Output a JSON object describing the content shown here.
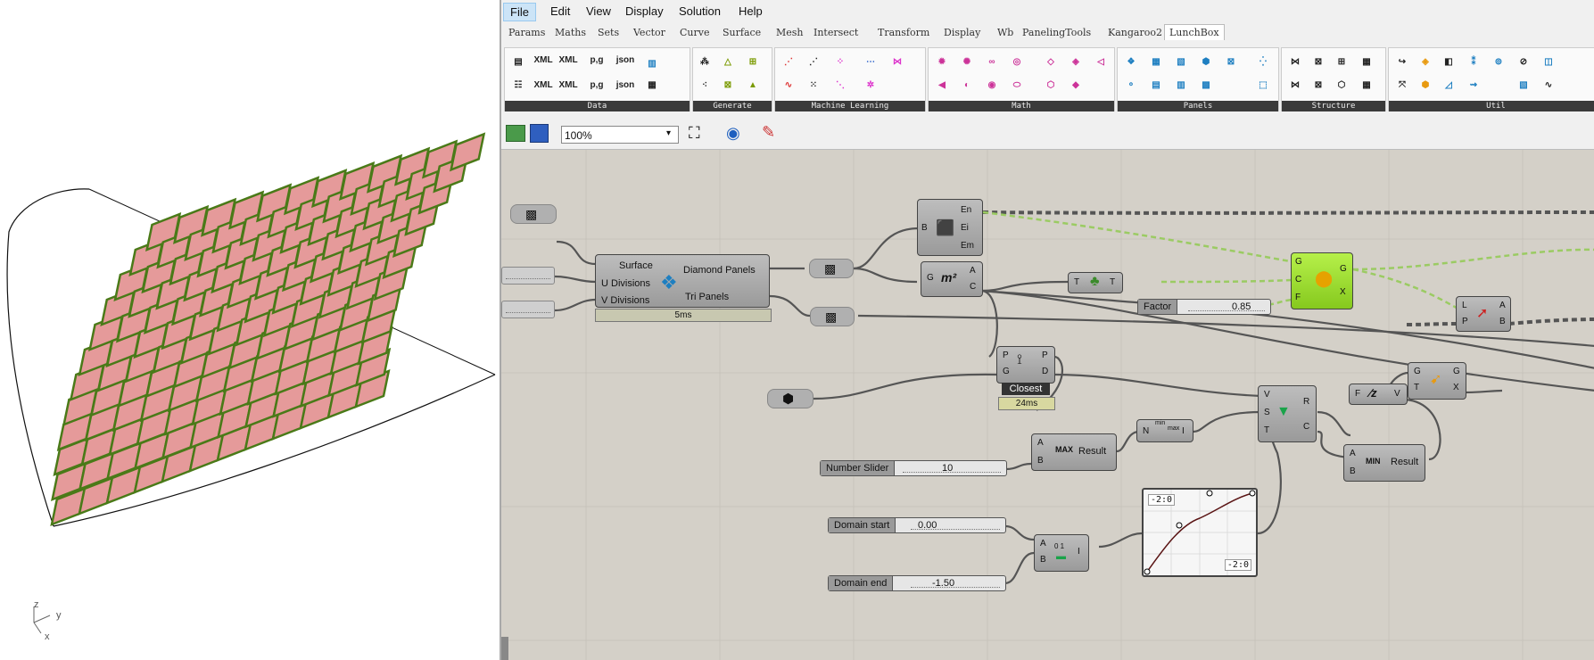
{
  "menu": [
    "File",
    "Edit",
    "View",
    "Display",
    "Solution",
    "Help"
  ],
  "tabs": [
    "Params",
    "Maths",
    "Sets",
    "Vector",
    "Curve",
    "Surface",
    "Mesh",
    "Intersect",
    "Transform",
    "Display",
    "Wb",
    "PanelingTools",
    "Kangaroo2",
    "LunchBox"
  ],
  "ribbon_groups": [
    "Data",
    "Generate",
    "Machine Learning",
    "Math",
    "Panels",
    "Structure",
    "Util"
  ],
  "ribbon_icon_text": {
    "xml": "XML",
    "pg": "p,g",
    "json": "json"
  },
  "zoom": "100%",
  "axes": {
    "z": "z",
    "y": "y",
    "x": "x"
  },
  "nodes": {
    "diamond": {
      "in1": "Surface",
      "in2": "U Divisions",
      "in3": "V Divisions",
      "out1": "Diamond Panels",
      "out2": "Tri Panels",
      "time": "5ms"
    },
    "energy": {
      "b": "B",
      "o1": "En",
      "o2": "Ei",
      "o3": "Em"
    },
    "area": {
      "g": "G",
      "a": "A",
      "c": "C",
      "icon": "m²"
    },
    "tree": {
      "t1": "T",
      "t2": "T"
    },
    "closest": {
      "p": "P",
      "g": "G",
      "p2": "P",
      "d": "D",
      "label": "Closest",
      "time": "24ms"
    },
    "green": {
      "g": "G",
      "c": "C",
      "f": "F",
      "g2": "G",
      "x": "X"
    },
    "lp": {
      "l": "L",
      "p": "P",
      "a": "A",
      "b": "B"
    },
    "gt": {
      "g": "G",
      "t": "T",
      "g2": "G",
      "x": "X"
    },
    "fv": {
      "f": "F",
      "v": "V"
    },
    "max": {
      "a": "A",
      "b": "B",
      "op": "MAX",
      "result": "Result"
    },
    "ni": {
      "n": "N",
      "i": "I",
      "tl": "min",
      "tr": "max"
    },
    "vst": {
      "v": "V",
      "s": "S",
      "t": "T",
      "r": "R",
      "c": "C"
    },
    "min": {
      "a": "A",
      "b": "B",
      "op": "MIN",
      "result": "Result"
    },
    "abi": {
      "a": "A",
      "b": "B",
      "i": "I",
      "bits": "0 1"
    },
    "graph": {
      "tl": "-2:0",
      "br": "-2:0"
    }
  },
  "sliders": {
    "factor": {
      "name": "Factor",
      "value": "0.85"
    },
    "number": {
      "name": "Number Slider",
      "value": "10"
    },
    "dstart": {
      "name": "Domain start",
      "value": "0.00"
    },
    "dend": {
      "name": "Domain end",
      "value": "-1.50"
    }
  }
}
